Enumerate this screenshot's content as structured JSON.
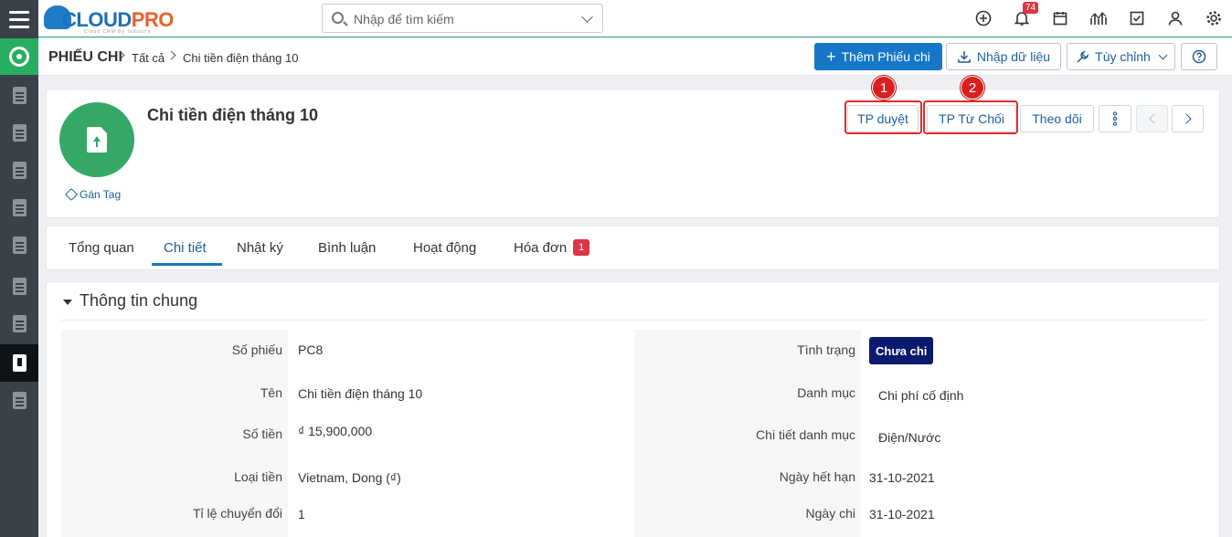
{
  "app": {
    "logo_main": "CLOUD",
    "logo_accent": "PRO",
    "logo_tagline": "Cloud CRM By Industry"
  },
  "search": {
    "placeholder": "Nhập để tìm kiếm"
  },
  "header": {
    "notification_count": "74"
  },
  "breadcrumb": {
    "module": "PHIẾU CHI",
    "level1": "Tất cả",
    "current": "Chi tiền điện tháng 10"
  },
  "toolbar": {
    "add_label": "Thêm Phiếu chi",
    "import_label": "Nhập dữ liệu",
    "customize_label": "Tùy chỉnh"
  },
  "record": {
    "title": "Chi tiền điện tháng 10",
    "tag_label": "Gán Tag",
    "actions": {
      "approve": "TP duyệt",
      "reject": "TP Từ Chối",
      "follow": "Theo dõi"
    },
    "annotations": [
      "1",
      "2"
    ]
  },
  "tabs": [
    {
      "label": "Tổng quan"
    },
    {
      "label": "Chi tiết"
    },
    {
      "label": "Nhật ký"
    },
    {
      "label": "Bình luận"
    },
    {
      "label": "Hoạt động"
    },
    {
      "label": "Hóa đơn",
      "badge": "1"
    }
  ],
  "section": {
    "title": "Thông tin chung",
    "left": [
      {
        "label": "Số phiếu",
        "value": "PC8"
      },
      {
        "label": "Tên",
        "value": "Chi tiền điện tháng 10"
      },
      {
        "label": "Số tiền",
        "value": "₫ 15,900,000"
      },
      {
        "label": "Loại tiền",
        "value": "Vietnam, Dong (₫)"
      },
      {
        "label": "Tỉ lệ chuyển đổi",
        "value": "1"
      }
    ],
    "right": [
      {
        "label": "Tình trạng",
        "value": "Chưa chi"
      },
      {
        "label": "Danh mục",
        "value": "Chi phí cố định"
      },
      {
        "label": "Chi tiết danh mục",
        "value": "Điện/Nước"
      },
      {
        "label": "Ngày hết hạn",
        "value": "31-10-2021"
      },
      {
        "label": "Ngày chi",
        "value": "31-10-2021"
      }
    ]
  },
  "colors": {
    "primary": "#1677c9",
    "accent_green": "#35a868",
    "status_badge": "#0b1a6e",
    "annotation_red": "#e52b2b"
  }
}
